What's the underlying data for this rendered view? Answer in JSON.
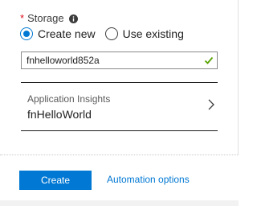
{
  "storage": {
    "required_mark": "*",
    "label": "Storage",
    "info_icon": "info-icon",
    "options": [
      {
        "label": "Create new",
        "selected": true
      },
      {
        "label": "Use existing",
        "selected": false
      }
    ],
    "input_value": "fnhelloworld852a",
    "valid_icon": "checkmark-icon"
  },
  "app_insights": {
    "label": "Application Insights",
    "value": "fnHelloWorld",
    "chevron_icon": "chevron-right-icon"
  },
  "footer": {
    "create_label": "Create",
    "automation_label": "Automation options"
  },
  "colors": {
    "accent": "#0078d4",
    "required": "#e00b1c",
    "valid": "#57a300"
  }
}
